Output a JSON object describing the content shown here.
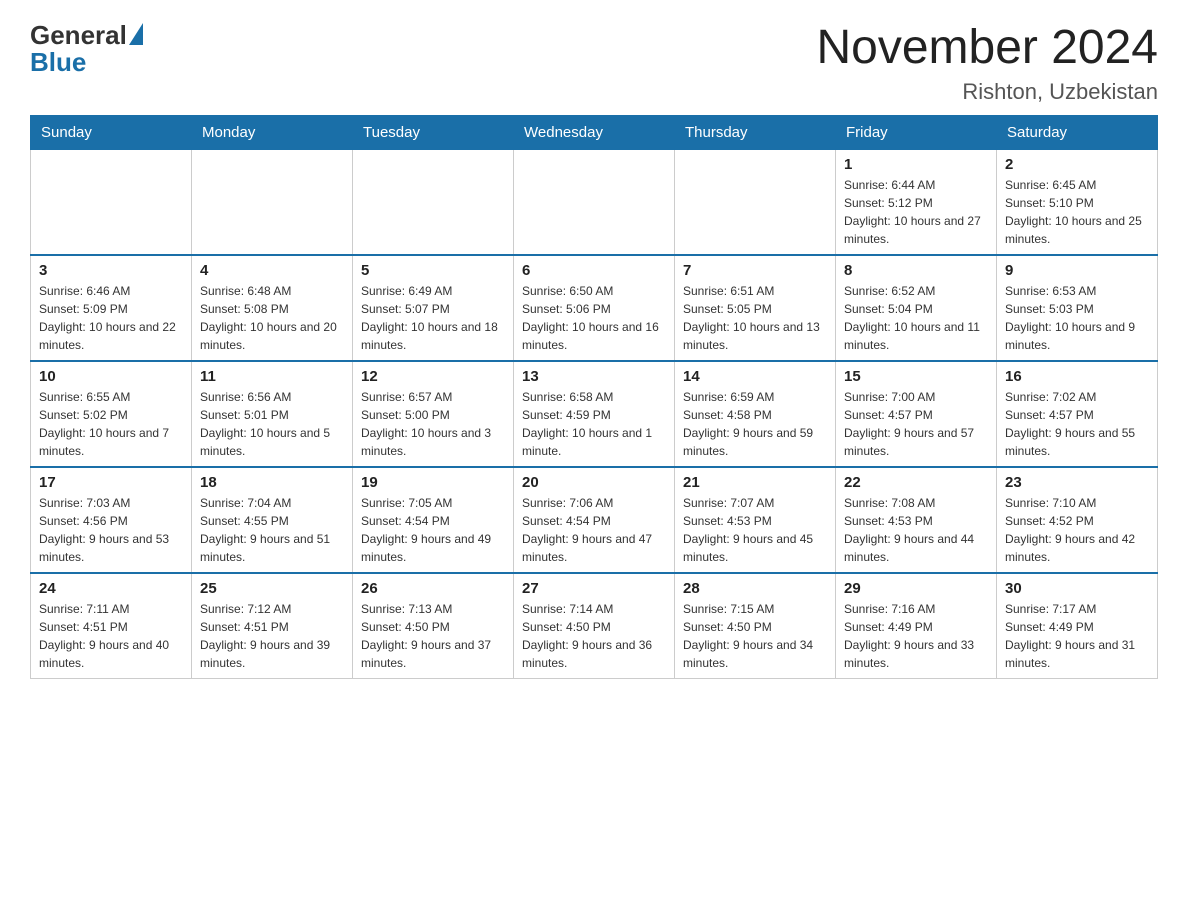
{
  "header": {
    "logo_general": "General",
    "logo_blue": "Blue",
    "title": "November 2024",
    "location": "Rishton, Uzbekistan"
  },
  "days_of_week": [
    "Sunday",
    "Monday",
    "Tuesday",
    "Wednesday",
    "Thursday",
    "Friday",
    "Saturday"
  ],
  "weeks": [
    {
      "days": [
        {
          "num": "",
          "info": ""
        },
        {
          "num": "",
          "info": ""
        },
        {
          "num": "",
          "info": ""
        },
        {
          "num": "",
          "info": ""
        },
        {
          "num": "",
          "info": ""
        },
        {
          "num": "1",
          "info": "Sunrise: 6:44 AM\nSunset: 5:12 PM\nDaylight: 10 hours and 27 minutes."
        },
        {
          "num": "2",
          "info": "Sunrise: 6:45 AM\nSunset: 5:10 PM\nDaylight: 10 hours and 25 minutes."
        }
      ]
    },
    {
      "days": [
        {
          "num": "3",
          "info": "Sunrise: 6:46 AM\nSunset: 5:09 PM\nDaylight: 10 hours and 22 minutes."
        },
        {
          "num": "4",
          "info": "Sunrise: 6:48 AM\nSunset: 5:08 PM\nDaylight: 10 hours and 20 minutes."
        },
        {
          "num": "5",
          "info": "Sunrise: 6:49 AM\nSunset: 5:07 PM\nDaylight: 10 hours and 18 minutes."
        },
        {
          "num": "6",
          "info": "Sunrise: 6:50 AM\nSunset: 5:06 PM\nDaylight: 10 hours and 16 minutes."
        },
        {
          "num": "7",
          "info": "Sunrise: 6:51 AM\nSunset: 5:05 PM\nDaylight: 10 hours and 13 minutes."
        },
        {
          "num": "8",
          "info": "Sunrise: 6:52 AM\nSunset: 5:04 PM\nDaylight: 10 hours and 11 minutes."
        },
        {
          "num": "9",
          "info": "Sunrise: 6:53 AM\nSunset: 5:03 PM\nDaylight: 10 hours and 9 minutes."
        }
      ]
    },
    {
      "days": [
        {
          "num": "10",
          "info": "Sunrise: 6:55 AM\nSunset: 5:02 PM\nDaylight: 10 hours and 7 minutes."
        },
        {
          "num": "11",
          "info": "Sunrise: 6:56 AM\nSunset: 5:01 PM\nDaylight: 10 hours and 5 minutes."
        },
        {
          "num": "12",
          "info": "Sunrise: 6:57 AM\nSunset: 5:00 PM\nDaylight: 10 hours and 3 minutes."
        },
        {
          "num": "13",
          "info": "Sunrise: 6:58 AM\nSunset: 4:59 PM\nDaylight: 10 hours and 1 minute."
        },
        {
          "num": "14",
          "info": "Sunrise: 6:59 AM\nSunset: 4:58 PM\nDaylight: 9 hours and 59 minutes."
        },
        {
          "num": "15",
          "info": "Sunrise: 7:00 AM\nSunset: 4:57 PM\nDaylight: 9 hours and 57 minutes."
        },
        {
          "num": "16",
          "info": "Sunrise: 7:02 AM\nSunset: 4:57 PM\nDaylight: 9 hours and 55 minutes."
        }
      ]
    },
    {
      "days": [
        {
          "num": "17",
          "info": "Sunrise: 7:03 AM\nSunset: 4:56 PM\nDaylight: 9 hours and 53 minutes."
        },
        {
          "num": "18",
          "info": "Sunrise: 7:04 AM\nSunset: 4:55 PM\nDaylight: 9 hours and 51 minutes."
        },
        {
          "num": "19",
          "info": "Sunrise: 7:05 AM\nSunset: 4:54 PM\nDaylight: 9 hours and 49 minutes."
        },
        {
          "num": "20",
          "info": "Sunrise: 7:06 AM\nSunset: 4:54 PM\nDaylight: 9 hours and 47 minutes."
        },
        {
          "num": "21",
          "info": "Sunrise: 7:07 AM\nSunset: 4:53 PM\nDaylight: 9 hours and 45 minutes."
        },
        {
          "num": "22",
          "info": "Sunrise: 7:08 AM\nSunset: 4:53 PM\nDaylight: 9 hours and 44 minutes."
        },
        {
          "num": "23",
          "info": "Sunrise: 7:10 AM\nSunset: 4:52 PM\nDaylight: 9 hours and 42 minutes."
        }
      ]
    },
    {
      "days": [
        {
          "num": "24",
          "info": "Sunrise: 7:11 AM\nSunset: 4:51 PM\nDaylight: 9 hours and 40 minutes."
        },
        {
          "num": "25",
          "info": "Sunrise: 7:12 AM\nSunset: 4:51 PM\nDaylight: 9 hours and 39 minutes."
        },
        {
          "num": "26",
          "info": "Sunrise: 7:13 AM\nSunset: 4:50 PM\nDaylight: 9 hours and 37 minutes."
        },
        {
          "num": "27",
          "info": "Sunrise: 7:14 AM\nSunset: 4:50 PM\nDaylight: 9 hours and 36 minutes."
        },
        {
          "num": "28",
          "info": "Sunrise: 7:15 AM\nSunset: 4:50 PM\nDaylight: 9 hours and 34 minutes."
        },
        {
          "num": "29",
          "info": "Sunrise: 7:16 AM\nSunset: 4:49 PM\nDaylight: 9 hours and 33 minutes."
        },
        {
          "num": "30",
          "info": "Sunrise: 7:17 AM\nSunset: 4:49 PM\nDaylight: 9 hours and 31 minutes."
        }
      ]
    }
  ]
}
